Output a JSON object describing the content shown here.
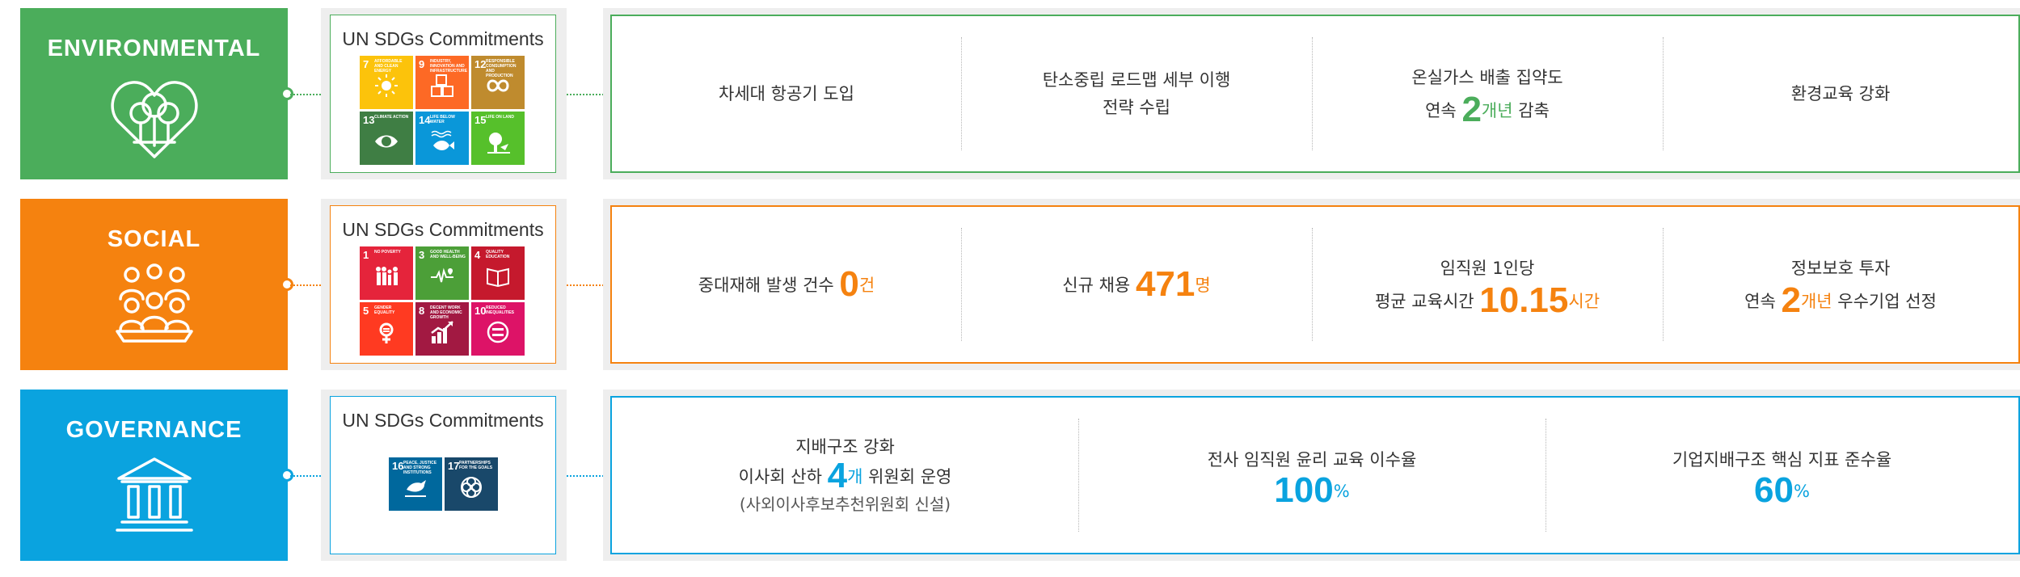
{
  "colors": {
    "environmental": "#4bad5b",
    "social": "#f5820f",
    "governance": "#0aa3df",
    "panel_bg": "#eeeeee"
  },
  "environmental": {
    "title": "ENVIRONMENTAL",
    "icon": "heart-tree-icon",
    "sdg_title": "UN SDGs Commitments",
    "sdgs": [
      {
        "num": "7",
        "label": "AFFORDABLE AND CLEAN ENERGY",
        "color": "#fcc30b",
        "icon": "sun-icon"
      },
      {
        "num": "9",
        "label": "INDUSTRY, INNOVATION AND INFRASTRUCTURE",
        "color": "#fd6925",
        "icon": "cubes-icon"
      },
      {
        "num": "12",
        "label": "RESPONSIBLE CONSUMPTION AND PRODUCTION",
        "color": "#bf8b2e",
        "icon": "infinity-icon"
      },
      {
        "num": "13",
        "label": "CLIMATE ACTION",
        "color": "#3f7e44",
        "icon": "eye-globe-icon"
      },
      {
        "num": "14",
        "label": "LIFE BELOW WATER",
        "color": "#0a97d9",
        "icon": "fish-icon"
      },
      {
        "num": "15",
        "label": "LIFE ON LAND",
        "color": "#56c02b",
        "icon": "tree-bird-icon"
      }
    ],
    "items": [
      {
        "text": "차세대 항공기 도입"
      },
      {
        "line1": "탄소중립 로드맵 세부 이행",
        "line2": "전략 수립"
      },
      {
        "line1": "온실가스 배출 집약도",
        "pre": "연속 ",
        "num": "2",
        "unit": "개년",
        "post": " 감축"
      },
      {
        "text": "환경교육 강화"
      }
    ]
  },
  "social": {
    "title": "SOCIAL",
    "icon": "people-group-icon",
    "sdg_title": "UN SDGs Commitments",
    "sdgs": [
      {
        "num": "1",
        "label": "NO POVERTY",
        "color": "#e5243b",
        "icon": "family-icon"
      },
      {
        "num": "3",
        "label": "GOOD HEALTH AND WELL-BEING",
        "color": "#4c9f38",
        "icon": "heartbeat-icon"
      },
      {
        "num": "4",
        "label": "QUALITY EDUCATION",
        "color": "#c5192d",
        "icon": "book-icon"
      },
      {
        "num": "5",
        "label": "GENDER EQUALITY",
        "color": "#ff3a21",
        "icon": "gender-icon"
      },
      {
        "num": "8",
        "label": "DECENT WORK AND ECONOMIC GROWTH",
        "color": "#a21942",
        "icon": "growth-chart-icon"
      },
      {
        "num": "10",
        "label": "REDUCED INEQUALITIES",
        "color": "#dd1367",
        "icon": "equal-icon"
      }
    ],
    "items": [
      {
        "pre": "중대재해 발생 건수 ",
        "num": "0",
        "unit": "건"
      },
      {
        "pre": "신규 채용 ",
        "num": "471",
        "unit": "명"
      },
      {
        "line1": "임직원 1인당",
        "pre": "평균 교육시간 ",
        "num": "10.15",
        "unit": "시간"
      },
      {
        "line1": "정보보호 투자",
        "pre": "연속 ",
        "num": "2",
        "unit": "개년",
        "post": " 우수기업 선정"
      }
    ]
  },
  "governance": {
    "title": "GOVERNANCE",
    "icon": "institution-building-icon",
    "sdg_title": "UN SDGs Commitments",
    "sdgs": [
      {
        "num": "16",
        "label": "PEACE, JUSTICE AND STRONG INSTITUTIONS",
        "color": "#00689d",
        "icon": "dove-icon"
      },
      {
        "num": "17",
        "label": "PARTNERSHIPS FOR THE GOALS",
        "color": "#19486a",
        "icon": "rings-icon"
      }
    ],
    "items": [
      {
        "line1": "지배구조 강화",
        "pre": "이사회 산하 ",
        "num": "4",
        "unit": "개",
        "post": " 위원회 운영",
        "line3": "(사외이사후보추천위원회 신설)"
      },
      {
        "line1": "전사 임직원 윤리 교육 이수율",
        "num": "100",
        "unit": "%"
      },
      {
        "line1": "기업지배구조 핵심 지표 준수율",
        "num": "60",
        "unit": "%"
      }
    ]
  }
}
